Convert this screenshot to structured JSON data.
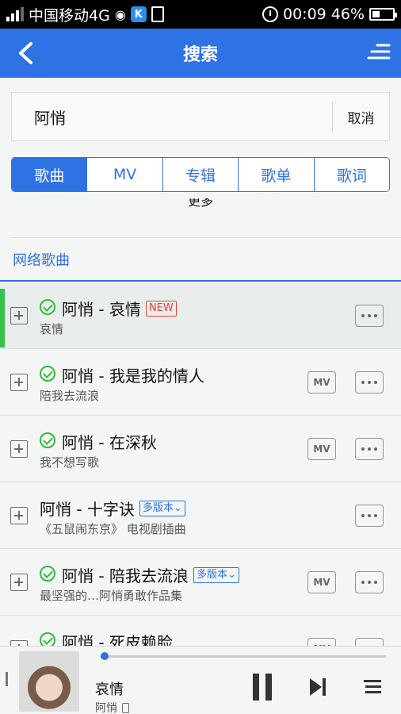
{
  "status_bar": {
    "carrier": "中国移动4G",
    "time": "00:09",
    "battery": "46%",
    "battery_level": 0.46
  },
  "header": {
    "title": "搜索",
    "back_icon": "back-arrow-icon",
    "menu_icon": "menu-icon"
  },
  "search": {
    "value": "阿悄",
    "cancel_label": "取消"
  },
  "tabs": [
    {
      "label": "歌曲",
      "active": true
    },
    {
      "label": "MV",
      "active": false
    },
    {
      "label": "专辑",
      "active": false
    },
    {
      "label": "歌单",
      "active": false
    },
    {
      "label": "歌词",
      "active": false
    }
  ],
  "cut_off_text": "更多",
  "section_title": "网络歌曲",
  "songs": [
    {
      "title": "阿悄 - 哀情",
      "subtitle": "哀情",
      "badge": "NEW",
      "badge_type": "new",
      "checked": true,
      "mv": false,
      "active": true
    },
    {
      "title": "阿悄 - 我是我的情人",
      "subtitle": "陪我去流浪",
      "badge": "",
      "badge_type": "",
      "checked": true,
      "mv": true,
      "active": false
    },
    {
      "title": "阿悄 - 在深秋",
      "subtitle": "我不想写歌",
      "badge": "",
      "badge_type": "",
      "checked": true,
      "mv": true,
      "active": false
    },
    {
      "title": "阿悄 - 十字诀",
      "subtitle": "《五鼠闹东京》 电视剧插曲",
      "badge": "多版本",
      "badge_type": "version",
      "checked": false,
      "mv": false,
      "active": false
    },
    {
      "title": "阿悄 - 陪我去流浪",
      "subtitle": "最坚强的…阿悄勇敢作品集",
      "badge": "多版本",
      "badge_type": "version",
      "checked": true,
      "mv": true,
      "active": false
    },
    {
      "title": "阿悄 - 死皮赖脸",
      "subtitle": "",
      "badge": "",
      "badge_type": "",
      "checked": true,
      "mv": true,
      "active": false
    }
  ],
  "mv_label": "MV",
  "player": {
    "song": "哀情",
    "artist": "阿悄",
    "progress": 0.01,
    "accent_color": "#2f72e3"
  }
}
